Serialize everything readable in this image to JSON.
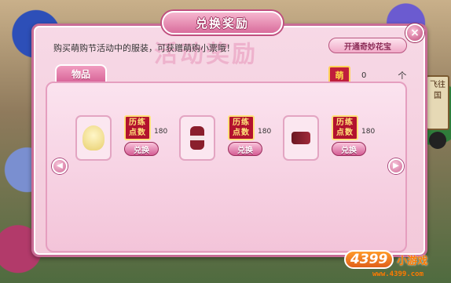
{
  "dialog": {
    "title": "兑换奖励",
    "close_label": "×",
    "description": "购买萌购节活动中的服装，可获赠萌购小票哦！",
    "watermark": "活动奖励",
    "open_button_label": "开通奇妙花宝",
    "tab_label": "物品"
  },
  "currency": {
    "icon_text": "萌",
    "value": "0",
    "unit": "个"
  },
  "items": [
    {
      "price_badge": "历练点数",
      "price_badge_line1": "历练",
      "price_badge_line2": "点数",
      "price": "180",
      "button": "兑换",
      "icon": "hair-item-icon"
    },
    {
      "price_badge": "历练点数",
      "price_badge_line1": "历练",
      "price_badge_line2": "点数",
      "price": "180",
      "button": "兑换",
      "icon": "dress-item-icon"
    },
    {
      "price_badge": "历练点数",
      "price_badge_line1": "历练",
      "price_badge_line2": "点数",
      "price": "180",
      "button": "兑换",
      "icon": "shoes-item-icon"
    }
  ],
  "nav": {
    "prev": "◀",
    "next": "▶"
  },
  "background": {
    "sign_text": "飞往国"
  },
  "branding": {
    "logo_main": "4399",
    "logo_sub": "小游戏",
    "url": "www.4399.com"
  }
}
